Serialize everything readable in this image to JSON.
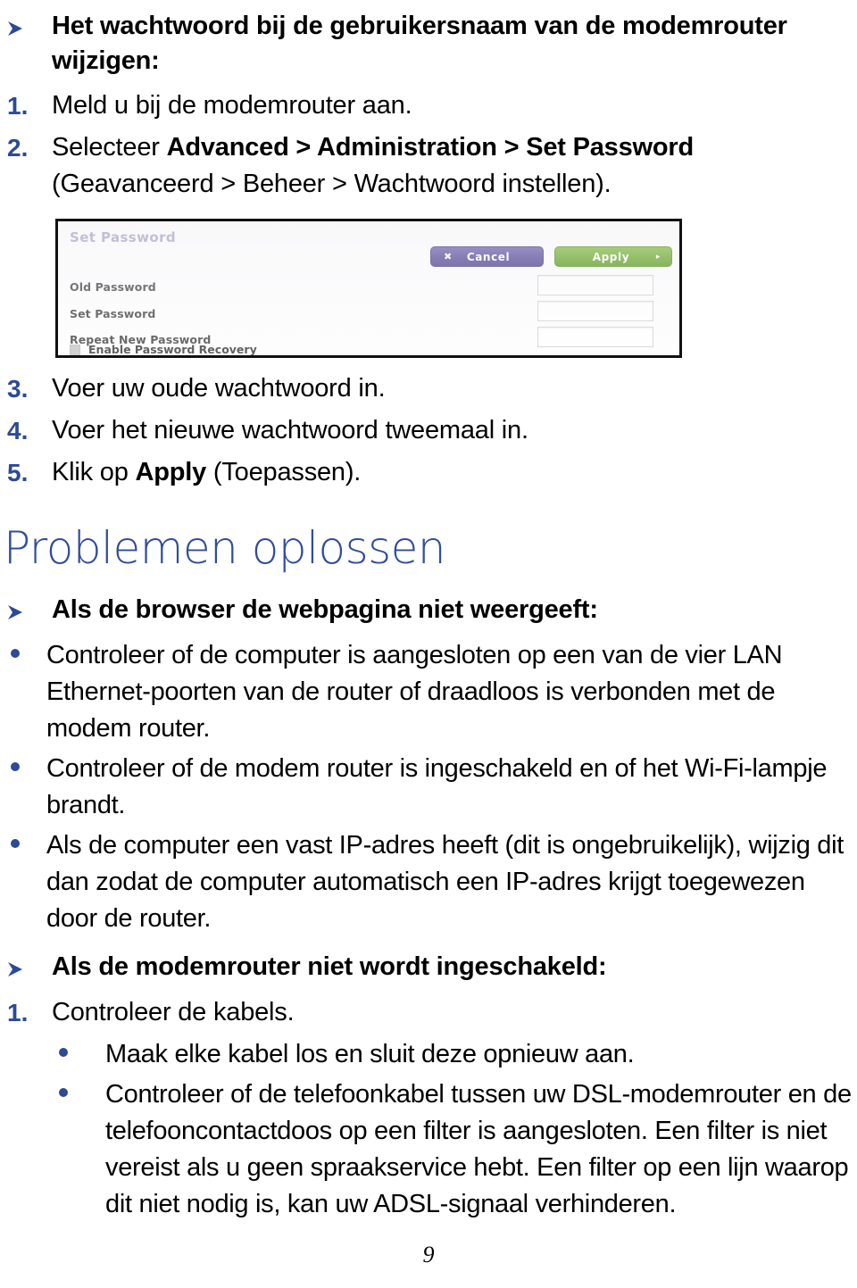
{
  "page": {
    "number": "9",
    "language": "nl"
  },
  "password_section": {
    "heading": "Het wachtwoord bij de gebruikersnaam van de modemrouter wijzigen:",
    "arrow_marker": "arrow-right-marker",
    "steps": [
      {
        "number": "1.",
        "text": "Meld u bij de modemrouter aan."
      },
      {
        "number": "2.",
        "text_before": "Selecteer ",
        "text_bold": "Advanced > Administration > Set Password",
        "text_after": " (Geavanceerd > Beheer > Wachtwoord instellen)."
      },
      {
        "number": "3.",
        "text": "Voer uw oude wachtwoord in."
      },
      {
        "number": "4.",
        "text": "Voer het nieuwe wachtwoord tweemaal in."
      },
      {
        "number": "5.",
        "text_before": "Klik op ",
        "text_bold": "Apply",
        "text_after": " (Toepassen)."
      }
    ]
  },
  "router_screenshot": {
    "panel_title": "Set Password",
    "cancel_button": {
      "label": "Cancel",
      "glyph": "✖",
      "color": "#584c97"
    },
    "apply_button": {
      "label": "Apply",
      "glyph": "▸",
      "color": "#6daa2c"
    },
    "fields": [
      {
        "label": "Old Password",
        "value": ""
      },
      {
        "label": "Set Password",
        "value": ""
      },
      {
        "label": "Repeat New Password",
        "value": ""
      }
    ],
    "recovery_checkbox": {
      "label": "Enable Password Recovery",
      "checked": false
    }
  },
  "troubleshooting": {
    "title": "Problemen oplossen",
    "title_color": "#2f4d9e",
    "groups": [
      {
        "heading": "Als de browser de webpagina niet weergeeft:",
        "bullets": [
          "Controleer of de computer is aangesloten op een van de vier LAN Ethernet-poorten van de router of draadloos is verbonden met de modem router.",
          "Controleer of de modem router is ingeschakeld en of het Wi-Fi-lampje brandt.",
          "Als de computer een vast IP-adres heeft (dit is ongebruikelijk), wijzig dit dan zodat de computer automatisch een IP-adres krijgt toegewezen door de router."
        ]
      },
      {
        "heading": "Als de modemrouter niet wordt ingeschakeld:",
        "steps": [
          {
            "number": "1.",
            "text": "Controleer de kabels."
          }
        ],
        "sub_bullets": [
          "Maak elke kabel los en sluit deze opnieuw aan.",
          "Controleer of de telefoonkabel tussen uw DSL-modemrouter en de telefooncontactdoos op een filter is aangesloten. Een filter is niet vereist als u geen spraakservice hebt. Een filter op een lijn waarop dit niet nodig is, kan uw ADSL-signaal verhinderen."
        ]
      }
    ]
  }
}
